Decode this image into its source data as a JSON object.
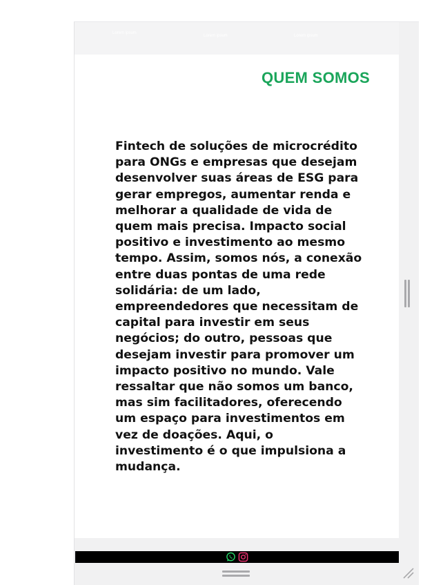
{
  "nav": {
    "items": [
      {
        "label": "Lorem ipsum"
      },
      {
        "label": "Lorem ipsum"
      },
      {
        "label": "Lorem ipsum"
      }
    ]
  },
  "section": {
    "title": "QUEM SOMOS",
    "body": "Fintech de soluções de microcrédito para ONGs e empresas que desejam desenvolver suas áreas de ESG para gerar empregos, aumentar renda e melhorar a qualidade de vida de quem mais precisa. Impacto social positivo e investimento ao mesmo tempo. Assim, somos nós, a conexão entre duas pontas de uma rede solidária: de um lado, empreendedores que necessitam de capital para investir em seus negócios; do outro, pessoas que desejam investir para promover um impacto positivo no mundo. Vale ressaltar que não somos um banco, mas sim facilitadores, oferecendo um espaço para investimentos em vez de doações. Aqui, o investimento é o que impulsiona a mudança."
  },
  "footer": {
    "icons": [
      "whatsapp-icon",
      "instagram-icon"
    ]
  },
  "colors": {
    "accent": "#1aa55a",
    "text": "#111111",
    "footer_bar": "#000000",
    "whatsapp": "#25d366",
    "instagram": "#e1306c"
  }
}
